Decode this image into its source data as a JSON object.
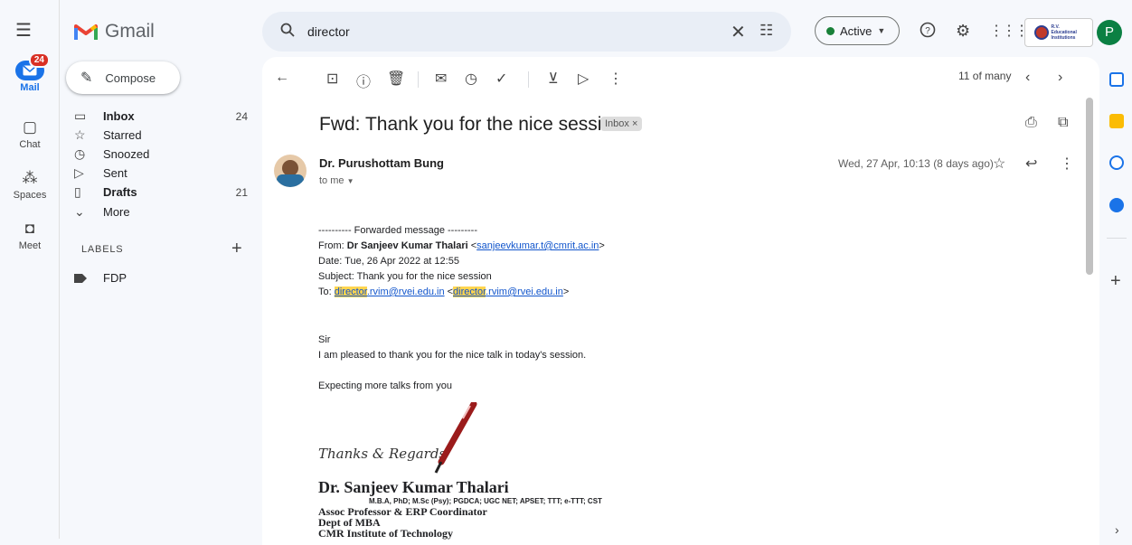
{
  "app": {
    "name": "Gmail"
  },
  "rail": {
    "mail_label": "Mail",
    "mail_badge": "24",
    "chat_label": "Chat",
    "spaces_label": "Spaces",
    "meet_label": "Meet"
  },
  "compose_label": "Compose",
  "nav": [
    {
      "label": "Inbox",
      "count": "24",
      "icon": "inbox-icon"
    },
    {
      "label": "Starred",
      "count": "",
      "icon": "star-icon"
    },
    {
      "label": "Snoozed",
      "count": "",
      "icon": "clock-icon"
    },
    {
      "label": "Sent",
      "count": "",
      "icon": "send-icon"
    },
    {
      "label": "Drafts",
      "count": "21",
      "icon": "draft-icon"
    },
    {
      "label": "More",
      "count": "",
      "icon": "chevron-down-icon"
    }
  ],
  "labels_heading": "LABELS",
  "labels": [
    {
      "label": "FDP"
    }
  ],
  "search": {
    "value": "director"
  },
  "status": {
    "label": "Active"
  },
  "toolbar": {
    "pager": "11 of many"
  },
  "email": {
    "subject": "Fwd: Thank you for the nice session",
    "chip": "Inbox",
    "sender": "Dr. Purushottam Bung",
    "to": "to me",
    "date": "Wed, 27 Apr, 10:13 (8 days ago)",
    "fwd_header": "---------- Forwarded message ---------",
    "from_prefix": "From: ",
    "from_name": "Dr Sanjeev Kumar Thalari",
    "from_email": "sanjeevkumar.t@cmrit.ac.in",
    "date_line": "Date: Tue, 26 Apr 2022 at 12:55",
    "subject_line": "Subject: Thank you for the nice session",
    "to_prefix": "To: ",
    "to_hl": "director",
    "to_rest": ".rvim@rvei.edu.in",
    "greeting": "Sir",
    "line1": "I am pleased to thank you for the nice talk in today's session.",
    "line2": "Expecting more talks from you",
    "thanks": "Thanks & Regards",
    "sig_name": "Dr. Sanjeev Kumar Thalari",
    "sig_creds": "M.B.A, PhD; M.Sc (Psy); PGDCA; UGC NET; APSET; TTT; e-TTT; CST",
    "sig_title": "Assoc Professor & ERP Coordinator",
    "sig_dept": "Dept of MBA",
    "sig_inst": "CMR Institute of Technology"
  },
  "org_logo_text": "R.V. Educational Institutions",
  "account_initial": "P",
  "colors": {
    "brand_red": "#ea4335",
    "accent_blue": "#1a73e8",
    "active_green": "#188038",
    "highlight": "#ffd54f"
  }
}
